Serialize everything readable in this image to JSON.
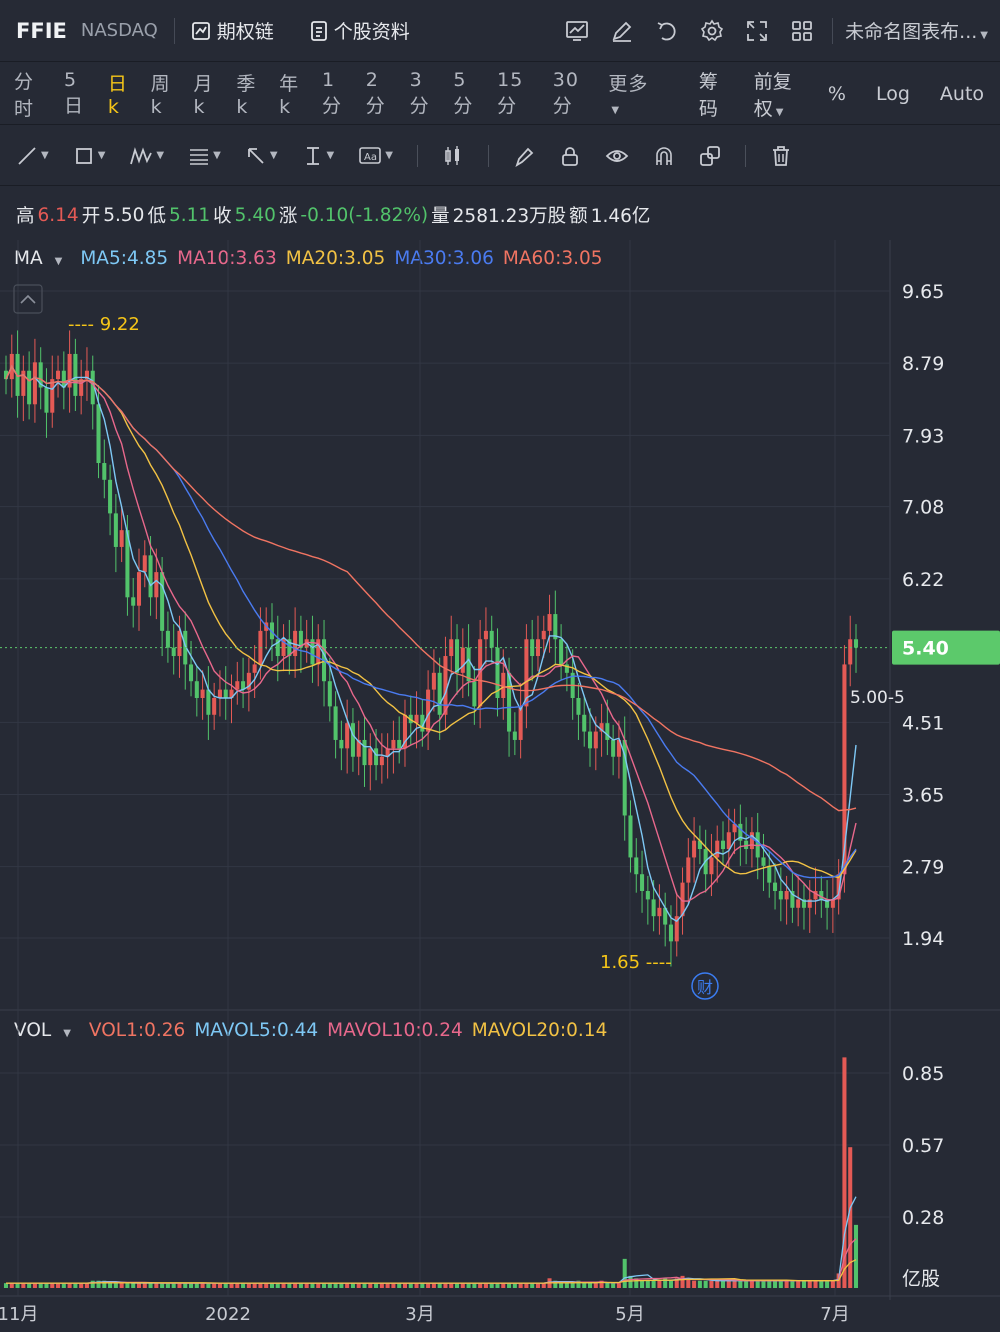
{
  "header": {
    "ticker": "FFIE",
    "exchange": "NASDAQ",
    "options_chain": "期权链",
    "stock_info": "个股资料",
    "layout_name": "未命名图表布...",
    "icons": [
      "chart-icon",
      "pencil-icon",
      "undo-icon",
      "gear-icon",
      "fullscreen-icon",
      "grid-layout-icon"
    ]
  },
  "periods": [
    "分时",
    "5日",
    "日k",
    "周k",
    "月k",
    "季k",
    "年k",
    "1分",
    "2分",
    "3分",
    "5分",
    "15分",
    "30分",
    "更多"
  ],
  "active_period": "日k",
  "period_options": {
    "chips": "筹码",
    "adjust": "前复权",
    "percent": "%",
    "log": "Log",
    "auto": "Auto"
  },
  "drawing_tools": [
    "line-tool-icon",
    "rectangle-tool-icon",
    "pattern-tool-icon",
    "fib-tool-icon",
    "arrow-tool-icon",
    "measure-tool-icon",
    "text-tool-icon",
    "candle-style-icon",
    "brush-icon",
    "lock-icon",
    "eye-icon",
    "magnet-icon",
    "copy-icon",
    "trash-icon"
  ],
  "quote": {
    "high_label": "高",
    "high": "6.14",
    "open_label": "开",
    "open": "5.50",
    "low_label": "低",
    "low": "5.11",
    "close_label": "收",
    "close": "5.40",
    "change_label": "涨",
    "change": "-0.10(-1.82%)",
    "volume_label": "量",
    "volume": "2581.23万股",
    "amount_label": "额",
    "amount": "1.46亿"
  },
  "ma_legend": {
    "name": "MA",
    "items": [
      {
        "label": "MA5:4.85",
        "color": "#7ec8f5"
      },
      {
        "label": "MA10:3.63",
        "color": "#e8688c"
      },
      {
        "label": "MA20:3.05",
        "color": "#f2c244"
      },
      {
        "label": "MA30:3.06",
        "color": "#4a7bf0"
      },
      {
        "label": "MA60:3.05",
        "color": "#f07462"
      }
    ]
  },
  "vol_legend": {
    "name": "VOL",
    "items": [
      {
        "label": "VOL1:0.26",
        "color": "#f07462"
      },
      {
        "label": "MAVOL5:0.44",
        "color": "#7ec8f5"
      },
      {
        "label": "MAVOL10:0.24",
        "color": "#e8688c"
      },
      {
        "label": "MAVOL20:0.14",
        "color": "#f2c244"
      }
    ]
  },
  "colors": {
    "up": "#e45a55",
    "down": "#52c36b",
    "last_price_bg": "#5cc96b",
    "annotation": "#f5c518",
    "earnings_badge": "#3b7cf0"
  },
  "annotations": {
    "max": "9.22",
    "min": "1.65",
    "last_line_label": "5.00-5",
    "earnings_badge": "财"
  },
  "current_price": "5.40",
  "chart_data": {
    "type": "candlestick",
    "price_axis_ticks": [
      9.65,
      8.79,
      7.93,
      7.08,
      6.22,
      5.4,
      4.51,
      3.65,
      2.79,
      1.94
    ],
    "price_range": [
      1.3,
      10.2
    ],
    "volume_axis_ticks": [
      "0.85",
      "0.57",
      "0.28",
      "亿股"
    ],
    "volume_range": [
      0,
      1.0
    ],
    "x_labels": [
      "11月",
      "2022",
      "3月",
      "5月",
      "7月"
    ],
    "series_close": [
      8.6,
      8.9,
      8.4,
      8.7,
      8.3,
      8.8,
      8.5,
      8.2,
      8.6,
      8.7,
      8.5,
      8.9,
      8.4,
      8.6,
      8.7,
      8.3,
      7.6,
      7.4,
      7.0,
      6.6,
      6.8,
      6.0,
      5.9,
      6.3,
      6.5,
      6.0,
      6.3,
      5.6,
      5.4,
      5.3,
      5.6,
      5.2,
      5.0,
      4.8,
      4.9,
      4.6,
      4.8,
      4.9,
      4.8,
      4.9,
      5.0,
      4.9,
      5.1,
      5.2,
      5.6,
      5.7,
      5.5,
      5.3,
      5.5,
      5.3,
      5.6,
      5.4,
      5.5,
      5.2,
      5.5,
      5.0,
      4.7,
      4.3,
      4.2,
      4.5,
      4.1,
      4.3,
      4.0,
      4.2,
      4.0,
      4.1,
      4.2,
      4.3,
      4.2,
      4.6,
      4.5,
      4.6,
      4.4,
      4.9,
      5.1,
      4.6,
      5.3,
      5.5,
      5.1,
      5.4,
      5.0,
      4.7,
      5.5,
      5.6,
      5.4,
      4.8,
      5.1,
      4.4,
      4.3,
      4.7,
      5.5,
      5.3,
      5.5,
      5.6,
      5.8,
      5.5,
      5.2,
      5.1,
      4.8,
      4.6,
      4.4,
      4.2,
      4.4,
      4.5,
      4.3,
      4.1,
      4.3,
      3.4,
      2.9,
      2.7,
      2.5,
      2.4,
      2.2,
      2.3,
      2.1,
      1.9,
      2.2,
      2.6,
      2.9,
      3.1,
      3.0,
      2.7,
      2.9,
      3.1,
      3.0,
      3.2,
      3.3,
      3.1,
      3.0,
      3.2,
      2.9,
      2.8,
      2.6,
      2.5,
      2.4,
      2.5,
      2.3,
      2.4,
      2.3,
      2.4,
      2.5,
      2.4,
      2.3,
      2.4,
      2.7,
      5.2,
      5.5,
      5.4
    ],
    "series_volume": [
      0.02,
      0.02,
      0.02,
      0.02,
      0.02,
      0.02,
      0.02,
      0.02,
      0.02,
      0.02,
      0.02,
      0.02,
      0.02,
      0.02,
      0.02,
      0.03,
      0.03,
      0.03,
      0.02,
      0.02,
      0.02,
      0.02,
      0.02,
      0.02,
      0.02,
      0.02,
      0.02,
      0.02,
      0.02,
      0.02,
      0.02,
      0.02,
      0.02,
      0.02,
      0.02,
      0.02,
      0.02,
      0.02,
      0.02,
      0.02,
      0.02,
      0.02,
      0.02,
      0.02,
      0.02,
      0.02,
      0.02,
      0.02,
      0.02,
      0.02,
      0.02,
      0.02,
      0.02,
      0.02,
      0.02,
      0.02,
      0.02,
      0.02,
      0.02,
      0.02,
      0.02,
      0.02,
      0.02,
      0.02,
      0.02,
      0.02,
      0.02,
      0.02,
      0.02,
      0.02,
      0.02,
      0.02,
      0.02,
      0.02,
      0.02,
      0.02,
      0.02,
      0.02,
      0.02,
      0.02,
      0.02,
      0.02,
      0.02,
      0.02,
      0.02,
      0.02,
      0.02,
      0.02,
      0.02,
      0.02,
      0.02,
      0.02,
      0.02,
      0.02,
      0.04,
      0.03,
      0.02,
      0.02,
      0.02,
      0.03,
      0.02,
      0.02,
      0.02,
      0.03,
      0.02,
      0.02,
      0.02,
      0.12,
      0.05,
      0.04,
      0.03,
      0.03,
      0.03,
      0.03,
      0.04,
      0.03,
      0.04,
      0.05,
      0.04,
      0.03,
      0.03,
      0.03,
      0.03,
      0.03,
      0.03,
      0.03,
      0.03,
      0.03,
      0.03,
      0.03,
      0.03,
      0.03,
      0.03,
      0.03,
      0.03,
      0.03,
      0.03,
      0.03,
      0.03,
      0.03,
      0.03,
      0.03,
      0.03,
      0.03,
      0.06,
      0.95,
      0.58,
      0.26
    ]
  }
}
